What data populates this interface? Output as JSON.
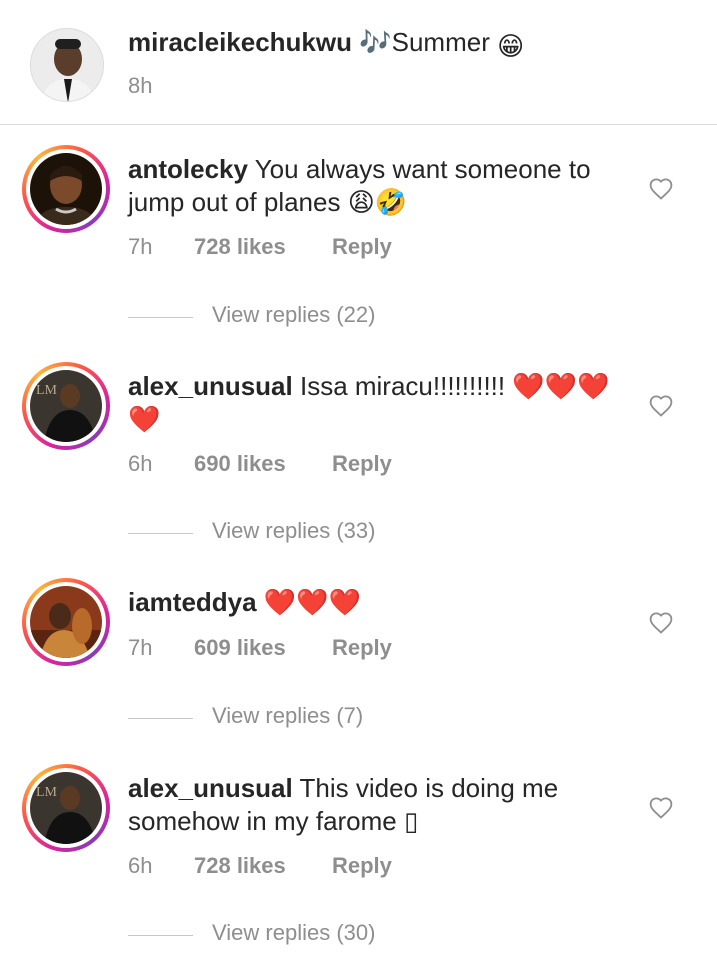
{
  "caption": {
    "username": "miracleikechukwu",
    "text_prefix": "🎶",
    "text": "Summer",
    "emoji": "😁",
    "time": "8h"
  },
  "comments": [
    {
      "username": "antolecky",
      "line1": "You always want someone to",
      "line2": "jump out of planes 😩🤣",
      "time": "7h",
      "likes": "728 likes",
      "reply": "Reply",
      "view_replies": "View replies (22)"
    },
    {
      "username": "alex_unusual",
      "line1": "Issa miracu!!!!!!!!!! ❤️❤️❤️",
      "line2": "❤️",
      "time": "6h",
      "likes": "690 likes",
      "reply": "Reply",
      "view_replies": "View replies (33)"
    },
    {
      "username": "iamteddya",
      "line1": "❤️❤️❤️",
      "time": "7h",
      "likes": "609 likes",
      "reply": "Reply",
      "view_replies": "View replies (7)"
    },
    {
      "username": "alex_unusual",
      "line1": "This video is doing me",
      "line2": "somehow in my farome ▯",
      "time": "6h",
      "likes": "728 likes",
      "reply": "Reply",
      "view_replies": "View replies (30)"
    }
  ],
  "icons": {
    "like": "heart-outline-icon"
  },
  "colors": {
    "text": "#262626",
    "secondary": "#8e8e8e",
    "divider": "#dbdbdb",
    "heart": "#e0245e"
  }
}
